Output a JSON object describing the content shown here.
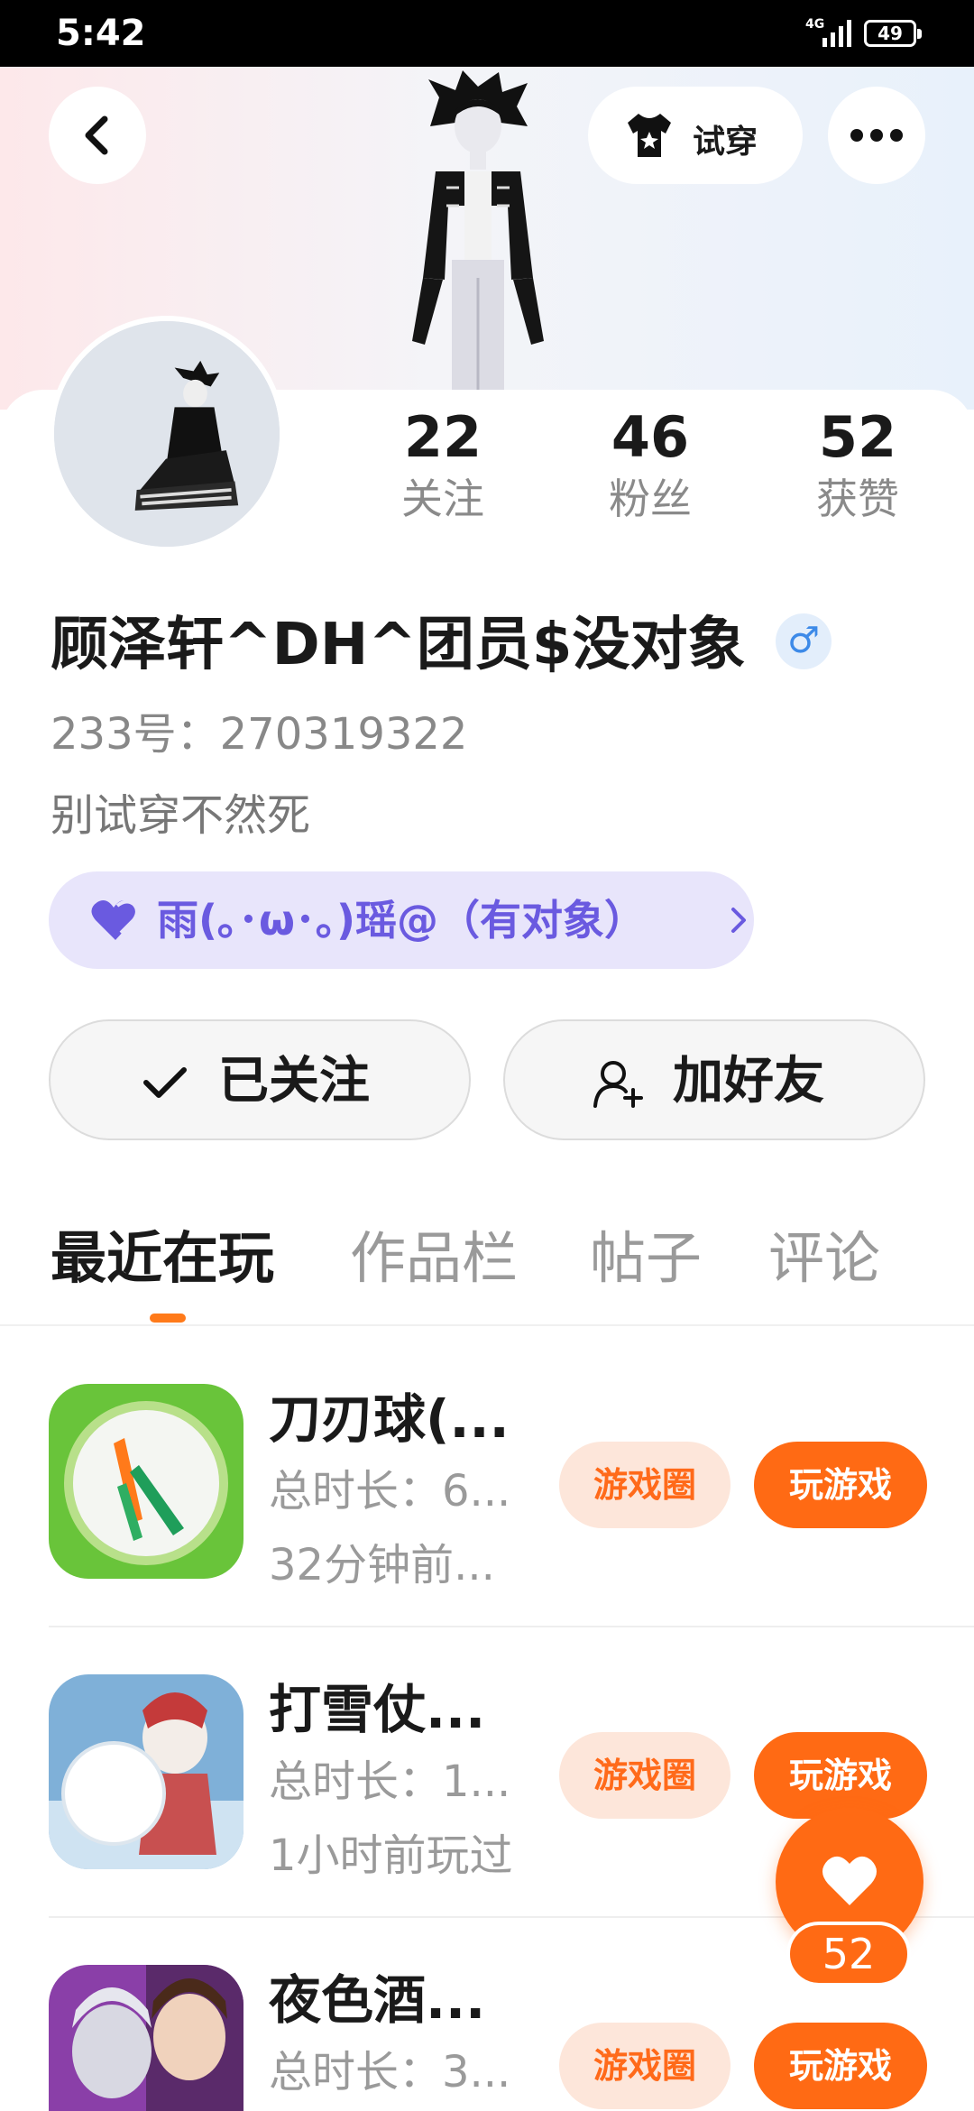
{
  "status_bar": {
    "time": "5:42",
    "network": "4G",
    "battery": "49"
  },
  "header": {
    "tryon_label": "试穿"
  },
  "stats": [
    {
      "value": "22",
      "label": "关注"
    },
    {
      "value": "46",
      "label": "粉丝"
    },
    {
      "value": "52",
      "label": "获赞"
    }
  ],
  "profile": {
    "nickname": "顾泽轩^DH^团员$没对象",
    "gender": "♂",
    "id_line": "233号：270319322",
    "bio": "别试穿不然死"
  },
  "cp_tag": {
    "label": "雨(｡･ω･｡)瑶@（有对象）"
  },
  "actions": {
    "follow_label": "已关注",
    "add_friend_label": "加好友"
  },
  "tabs": [
    "最近在玩",
    "作品栏",
    "帖子",
    "评论"
  ],
  "games": [
    {
      "name": "刀刃球(...",
      "duration": "总时长：6...",
      "last_played": "32分钟前...",
      "circle_label": "游戏圈",
      "play_label": "玩游戏"
    },
    {
      "name": "打雪仗...",
      "duration": "总时长：1...",
      "last_played": "1小时前玩过",
      "circle_label": "游戏圈",
      "play_label": "玩游戏"
    },
    {
      "name": "夜色酒...",
      "duration": "总时长：3...",
      "last_played": "",
      "circle_label": "游戏圈",
      "play_label": "玩游戏"
    }
  ],
  "like_fab": {
    "count": "52"
  },
  "colors": {
    "accent": "#ff6a14",
    "accent_light": "#fde6da",
    "cp_purple": "#6a5ae0",
    "cp_bg": "#e8e5fb",
    "gender_blue": "#3d8ae8"
  }
}
